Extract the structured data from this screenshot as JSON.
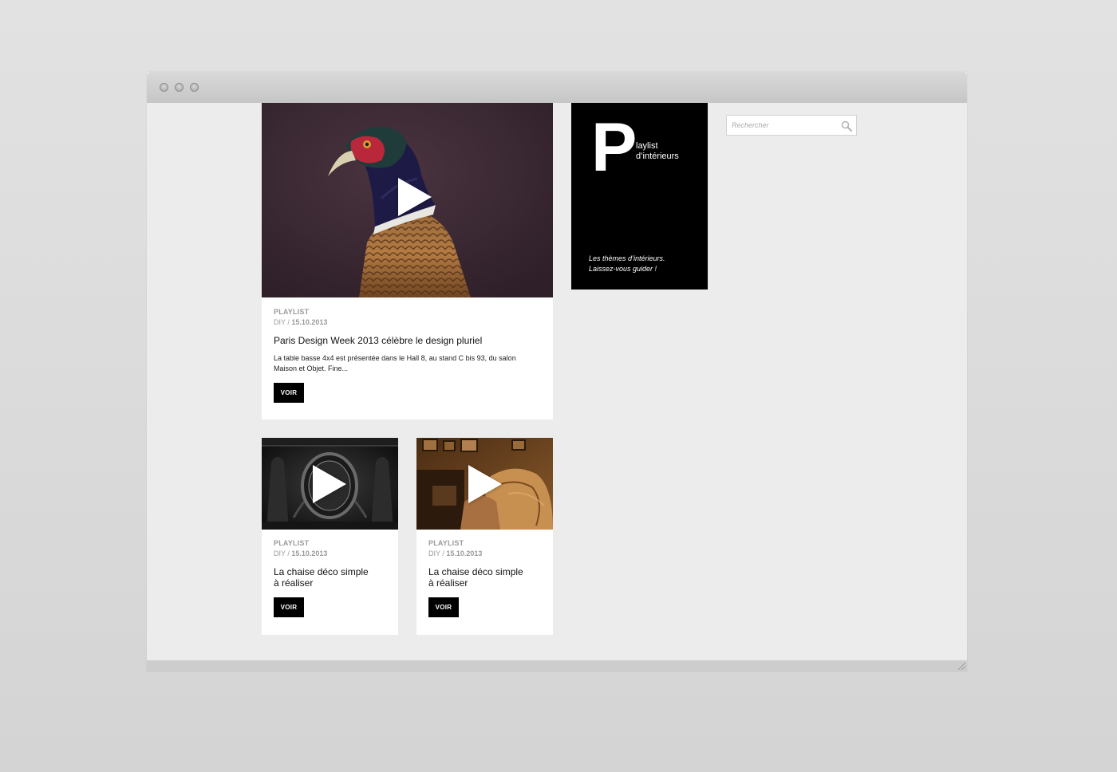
{
  "search": {
    "placeholder": "Rechercher"
  },
  "playlist_panel": {
    "letter": "P",
    "title_line1": "laylist",
    "title_line2": "d’intérieurs",
    "subtitle_line1": "Les thèmes d’intérieurs.",
    "subtitle_line2": "Laissez-vous guider !"
  },
  "featured": {
    "image": "pheasant-photo",
    "kind": "PLAYLIST",
    "category": "DIY",
    "date": "15.10.2013",
    "title": "Paris Design Week 2013 célèbre le design pluriel",
    "excerpt_line1": "La table basse 4x4 est présentée dans le Hall 8, au stand C bis 93, du salon",
    "excerpt_line2": "Maison et Objet. Fine...",
    "button": "VOIR"
  },
  "cards": [
    {
      "image": "ornate-mirror-photo",
      "kind": "PLAYLIST",
      "category": "DIY",
      "date": "15.10.2013",
      "title_line1": "La chaise déco simple",
      "title_line2": "à réaliser",
      "button": "VOIR"
    },
    {
      "image": "leather-workshop-photo",
      "kind": "PLAYLIST",
      "category": "DIY",
      "date": "15.10.2013",
      "title_line1": "La chaise déco simple",
      "title_line2": "à réaliser",
      "button": "VOIR"
    }
  ],
  "colors": {
    "panel_bg": "#000000",
    "button_bg": "#000000",
    "page_bg": "#ececec",
    "meta_text": "#9a9a9a"
  }
}
